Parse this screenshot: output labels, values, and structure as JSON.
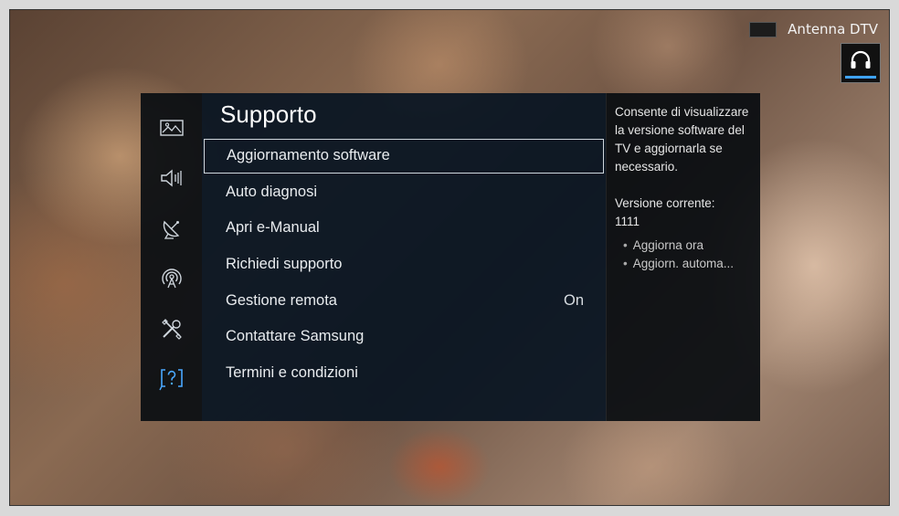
{
  "source": {
    "label": "Antenna DTV"
  },
  "audio_button": {
    "icon": "headphone-icon",
    "accent_color": "#3fa3ff"
  },
  "sidebar": {
    "items": [
      {
        "icon": "picture-icon",
        "selected": false
      },
      {
        "icon": "sound-icon",
        "selected": false
      },
      {
        "icon": "broadcast-icon",
        "selected": false
      },
      {
        "icon": "network-icon",
        "selected": false
      },
      {
        "icon": "system-tools-icon",
        "selected": false
      },
      {
        "icon": "support-icon",
        "selected": true
      }
    ],
    "accent_color": "#4aa8ff"
  },
  "menu": {
    "title": "Supporto",
    "items": [
      {
        "label": "Aggiornamento software",
        "value": ""
      },
      {
        "label": "Auto diagnosi",
        "value": ""
      },
      {
        "label": "Apri e-Manual",
        "value": ""
      },
      {
        "label": "Richiedi supporto",
        "value": ""
      },
      {
        "label": "Gestione remota",
        "value": "On"
      },
      {
        "label": "Contattare Samsung",
        "value": ""
      },
      {
        "label": "Termini e condizioni",
        "value": ""
      }
    ]
  },
  "info_panel": {
    "description": "Consente di visualizzare la versione software del TV e aggiornarla se necessario.",
    "version_label": "Versione corrente:",
    "version_value": "1111",
    "options": [
      "Aggiorna ora",
      "Aggiorn. automa..."
    ]
  }
}
